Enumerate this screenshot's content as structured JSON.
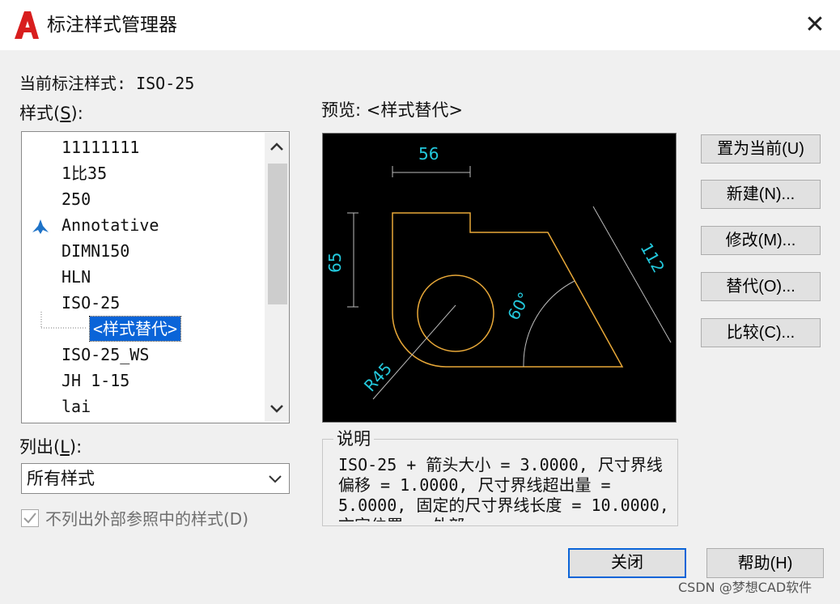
{
  "window": {
    "title": "标注样式管理器",
    "close_glyph": "✕"
  },
  "current_style": "当前标注样式: ISO-25",
  "styles": {
    "label_prefix": "样式(",
    "label_key": "S",
    "label_suffix": "):",
    "items": [
      "11111111",
      "1比35",
      "250",
      "Annotative",
      "DIMN150",
      "HLN",
      "ISO-25",
      "ISO-25_WS",
      "JH 1-15",
      "lai"
    ],
    "selected_override": "<样式替代>"
  },
  "list_filter": {
    "label_prefix": "列出(",
    "label_key": "L",
    "label_suffix": "):",
    "value": "所有样式"
  },
  "xref_checkbox": {
    "label": "不列出外部参照中的样式(D)",
    "checked": true
  },
  "preview": {
    "label": "预览: <样式替代>",
    "dim_56": "56",
    "dim_65": "65",
    "dim_112": "112",
    "dim_angle": "60°",
    "dim_radius": "R45"
  },
  "description": {
    "legend": "说明",
    "text": "ISO-25 + 箭头大小 = 3.0000, 尺寸界线偏移 = 1.0000, 尺寸界线超出量 = 5.0000, 固定的尺寸界线长度 = 10.0000, 文字位置 = 外部"
  },
  "buttons": {
    "set_current": "置为当前(U)",
    "new": "新建(N)...",
    "modify": "修改(M)...",
    "override": "替代(O)...",
    "compare": "比较(C)...",
    "close": "关闭",
    "help": "帮助(H)"
  },
  "watermark": "CSDN @梦想CAD软件",
  "colors": {
    "geometry": "#e8a838",
    "dimension": "#23c8dc",
    "selection": "#0a64d8"
  }
}
